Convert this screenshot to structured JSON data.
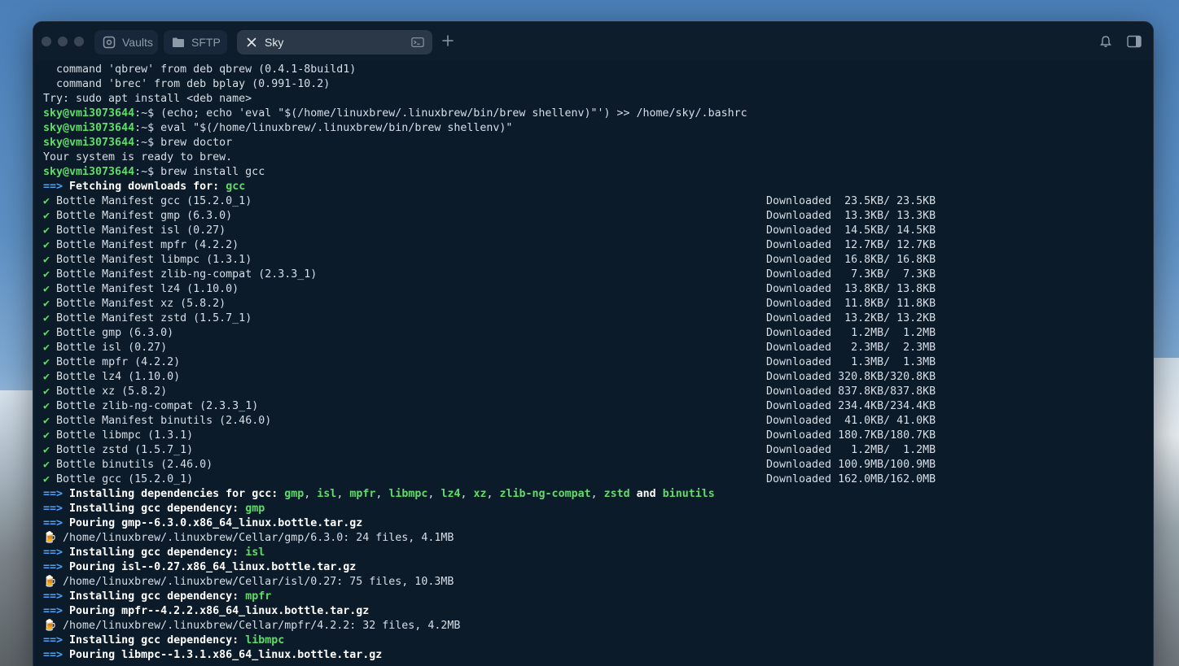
{
  "window": {
    "tabs": [
      {
        "label": "Vaults",
        "icon": "vault-icon"
      },
      {
        "label": "SFTP",
        "icon": "folder-icon"
      },
      {
        "label": "Sky",
        "icon": "close-icon",
        "active": true
      }
    ],
    "colors": {
      "background": "#0c1b2a",
      "prompt": "#5fdc6a",
      "arrow": "#4aa3ff"
    }
  },
  "terminal": {
    "pre": [
      "  command 'qbrew' from deb qbrew (0.4.1-8build1)",
      "  command 'brec' from deb bplay (0.991-10.2)",
      "Try: sudo apt install <deb name>"
    ],
    "prompt": "sky@vmi3073644",
    "prompt_suffix": ":~$ ",
    "commands": [
      "(echo; echo 'eval \"$(/home/linuxbrew/.linuxbrew/bin/brew shellenv)\"') >> /home/sky/.bashrc",
      "eval \"$(/home/linuxbrew/.linuxbrew/bin/brew shellenv)\"",
      "brew doctor",
      "brew install gcc"
    ],
    "doctor_output": "Your system is ready to brew.",
    "fetching": {
      "arrow": "==>",
      "text": "Fetching downloads for: ",
      "pkg": "gcc"
    },
    "downloads": [
      {
        "name": "Bottle Manifest gcc (15.2.0_1)",
        "status": "Downloaded",
        "size": "  23.5KB/ 23.5KB"
      },
      {
        "name": "Bottle Manifest gmp (6.3.0)",
        "status": "Downloaded",
        "size": "  13.3KB/ 13.3KB"
      },
      {
        "name": "Bottle Manifest isl (0.27)",
        "status": "Downloaded",
        "size": "  14.5KB/ 14.5KB"
      },
      {
        "name": "Bottle Manifest mpfr (4.2.2)",
        "status": "Downloaded",
        "size": "  12.7KB/ 12.7KB"
      },
      {
        "name": "Bottle Manifest libmpc (1.3.1)",
        "status": "Downloaded",
        "size": "  16.8KB/ 16.8KB"
      },
      {
        "name": "Bottle Manifest zlib-ng-compat (2.3.3_1)",
        "status": "Downloaded",
        "size": "   7.3KB/  7.3KB"
      },
      {
        "name": "Bottle Manifest lz4 (1.10.0)",
        "status": "Downloaded",
        "size": "  13.8KB/ 13.8KB"
      },
      {
        "name": "Bottle Manifest xz (5.8.2)",
        "status": "Downloaded",
        "size": "  11.8KB/ 11.8KB"
      },
      {
        "name": "Bottle Manifest zstd (1.5.7_1)",
        "status": "Downloaded",
        "size": "  13.2KB/ 13.2KB"
      },
      {
        "name": "Bottle gmp (6.3.0)",
        "status": "Downloaded",
        "size": "   1.2MB/  1.2MB"
      },
      {
        "name": "Bottle isl (0.27)",
        "status": "Downloaded",
        "size": "   2.3MB/  2.3MB"
      },
      {
        "name": "Bottle mpfr (4.2.2)",
        "status": "Downloaded",
        "size": "   1.3MB/  1.3MB"
      },
      {
        "name": "Bottle lz4 (1.10.0)",
        "status": "Downloaded",
        "size": " 320.8KB/320.8KB"
      },
      {
        "name": "Bottle xz (5.8.2)",
        "status": "Downloaded",
        "size": " 837.8KB/837.8KB"
      },
      {
        "name": "Bottle zlib-ng-compat (2.3.3_1)",
        "status": "Downloaded",
        "size": " 234.4KB/234.4KB"
      },
      {
        "name": "Bottle Manifest binutils (2.46.0)",
        "status": "Downloaded",
        "size": "  41.0KB/ 41.0KB"
      },
      {
        "name": "Bottle libmpc (1.3.1)",
        "status": "Downloaded",
        "size": " 180.7KB/180.7KB"
      },
      {
        "name": "Bottle zstd (1.5.7_1)",
        "status": "Downloaded",
        "size": "   1.2MB/  1.2MB"
      },
      {
        "name": "Bottle binutils (2.46.0)",
        "status": "Downloaded",
        "size": " 100.9MB/100.9MB"
      },
      {
        "name": "Bottle gcc (15.2.0_1)",
        "status": "Downloaded",
        "size": " 162.0MB/162.0MB"
      }
    ],
    "deps_line": {
      "arrow": "==>",
      "text": "Installing dependencies for gcc: ",
      "pkgs": [
        "gmp",
        "isl",
        "mpfr",
        "libmpc",
        "lz4",
        "xz",
        "zlib-ng-compat",
        "zstd"
      ],
      "and": "and",
      "last": "binutils"
    },
    "installs": [
      {
        "dep_text": "Installing gcc dependency: ",
        "dep": "gmp",
        "pour": "Pouring gmp--6.3.0.x86_64_linux.bottle.tar.gz",
        "cellar": "/home/linuxbrew/.linuxbrew/Cellar/gmp/6.3.0: 24 files, 4.1MB"
      },
      {
        "dep_text": "Installing gcc dependency: ",
        "dep": "isl",
        "pour": "Pouring isl--0.27.x86_64_linux.bottle.tar.gz",
        "cellar": "/home/linuxbrew/.linuxbrew/Cellar/isl/0.27: 75 files, 10.3MB"
      },
      {
        "dep_text": "Installing gcc dependency: ",
        "dep": "mpfr",
        "pour": "Pouring mpfr--4.2.2.x86_64_linux.bottle.tar.gz",
        "cellar": "/home/linuxbrew/.linuxbrew/Cellar/mpfr/4.2.2: 32 files, 4.2MB"
      },
      {
        "dep_text": "Installing gcc dependency: ",
        "dep": "libmpc",
        "pour": "Pouring libmpc--1.3.1.x86_64_linux.bottle.tar.gz",
        "cellar": ""
      }
    ],
    "check_glyph": "✔",
    "beer_glyph": "🍺"
  }
}
